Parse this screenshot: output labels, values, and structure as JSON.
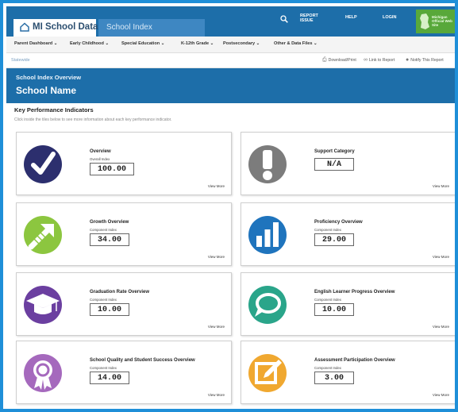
{
  "header": {
    "logo_text": "MI School Data",
    "section_tab": "School Index",
    "report_issue": "REPORT ISSUE",
    "help": "HELP",
    "login": "LOGIN",
    "state_badge": "Michigan Official Web Site"
  },
  "nav": {
    "items": [
      "Parent Dashboard",
      "Early Childhood",
      "Special Education",
      "K-12th Grade",
      "Postsecondary",
      "Other & Data Files"
    ]
  },
  "toolbar": {
    "breadcrumb": "Statewide",
    "download": "Download/Print",
    "link": "Link to Report",
    "notify": "Notify This Report"
  },
  "band": {
    "subtitle": "School Index Overview",
    "title": "School Name"
  },
  "kpi": {
    "heading": "Key Performance Indicators",
    "description": "Click inside the tiles below to see more information about each key performance indicator."
  },
  "cards": [
    {
      "title": "Overview",
      "sub": "Overall Index",
      "value": "100.00",
      "more": "View More",
      "icon": "checkmark-icon",
      "color": "#2c2f6e"
    },
    {
      "title": "Support Category",
      "sub": "",
      "value": "N/A",
      "more": "View More",
      "icon": "exclamation-icon",
      "color": "#7c7c7c"
    },
    {
      "title": "Growth Overview",
      "sub": "Component Index",
      "value": "34.00",
      "more": "View More",
      "icon": "growth-arrow-icon",
      "color": "#8cc63f"
    },
    {
      "title": "Proficiency Overview",
      "sub": "Component Index",
      "value": "29.00",
      "more": "View More",
      "icon": "bar-chart-icon",
      "color": "#1f74bd"
    },
    {
      "title": "Graduation Rate Overview",
      "sub": "Component Index",
      "value": "10.00",
      "more": "View More",
      "icon": "graduation-cap-icon",
      "color": "#6b3fa0"
    },
    {
      "title": "English Learner Progress Overview",
      "sub": "Component Index",
      "value": "10.00",
      "more": "View More",
      "icon": "speech-bubble-icon",
      "color": "#2aa58a"
    },
    {
      "title": "School Quality and Student Success Overview",
      "sub": "Component Index",
      "value": "14.00",
      "more": "View More",
      "icon": "award-ribbon-icon",
      "color": "#a569bd"
    },
    {
      "title": "Assessment Participation Overview",
      "sub": "Component Index",
      "value": "3.00",
      "more": "View More",
      "icon": "edit-pencil-icon",
      "color": "#f0a830"
    }
  ]
}
